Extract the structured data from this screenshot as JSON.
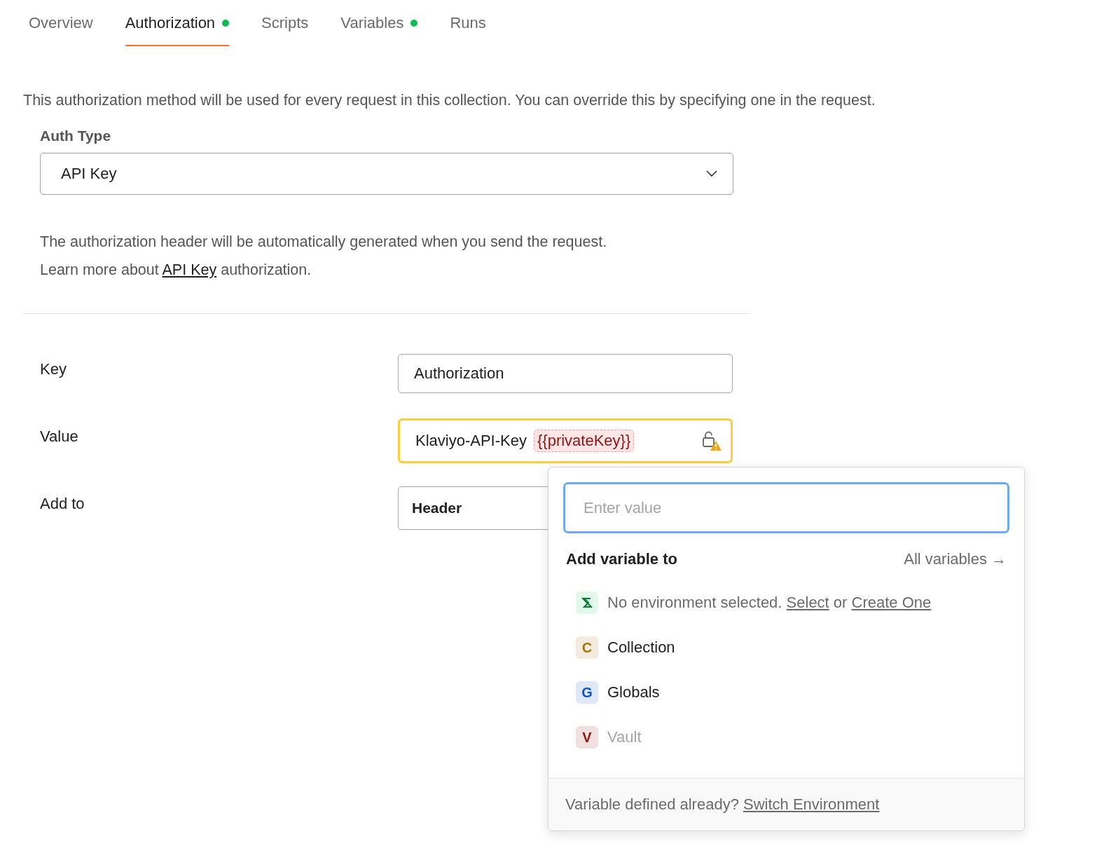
{
  "tabs": [
    {
      "label": "Overview",
      "selected": false,
      "dot": false
    },
    {
      "label": "Authorization",
      "selected": true,
      "dot": true
    },
    {
      "label": "Scripts",
      "selected": false,
      "dot": false
    },
    {
      "label": "Variables",
      "selected": false,
      "dot": true
    },
    {
      "label": "Runs",
      "selected": false,
      "dot": false
    }
  ],
  "description": "This authorization method will be used for every request in this collection. You can override this by specifying one in the request.",
  "auth_type": {
    "label": "Auth Type",
    "value": "API Key"
  },
  "help": {
    "line1": "The authorization header will be automatically generated when you send the request.",
    "line2": [
      {
        "text": "Learn more about "
      },
      {
        "link": "API Key"
      },
      {
        "text": " authorization."
      }
    ]
  },
  "fields": [
    {
      "label": "Key",
      "kind": "text",
      "value": "Authorization"
    },
    {
      "label": "Value",
      "kind": "variable",
      "value": "Klaviyo-API-Key",
      "variable": "{{privateKey}}",
      "warning": true
    },
    {
      "label": "Add to",
      "kind": "select",
      "value": "Header"
    }
  ],
  "popup": {
    "input": {
      "placeholder": "Enter value"
    },
    "heading": "Add variable to",
    "all_link": "All variables →",
    "items": [
      {
        "kind": "environment",
        "parts": [
          {
            "text": "No environment selected. "
          },
          {
            "link": "Select"
          },
          {
            "text": " or "
          },
          {
            "link": "Create One"
          }
        ],
        "disabled": false
      },
      {
        "kind": "scope",
        "badge": "C",
        "label": "Collection",
        "color": "#a8730b",
        "disabled": false
      },
      {
        "kind": "scope",
        "badge": "G",
        "label": "Globals",
        "color": "#0b55c4",
        "disabled": false
      },
      {
        "kind": "scope",
        "badge": "V",
        "label": "Vault",
        "color": "#8f1414",
        "disabled": true
      }
    ],
    "footer": [
      {
        "text": "Variable defined already? "
      },
      {
        "link": "Switch Environment"
      }
    ]
  }
}
